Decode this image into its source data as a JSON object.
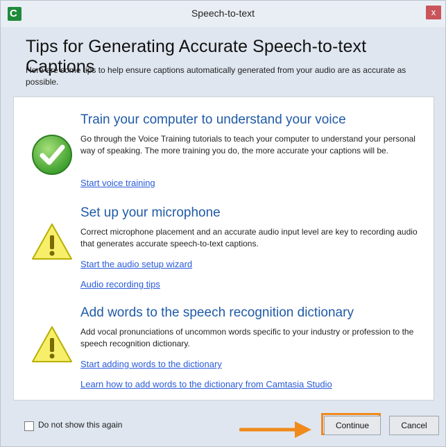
{
  "window": {
    "title": "Speech-to-text",
    "close_label": "x",
    "app_icon_letter": "C"
  },
  "header": {
    "title": "Tips for Generating Accurate Speech-to-text Captions",
    "description": "Here are some tips to help ensure captions automatically generated from your audio are as accurate as possible."
  },
  "tips": [
    {
      "title": "Train your computer to understand your voice",
      "text": "Go through the Voice Training tutorials to teach your computer to understand your personal way of speaking. The more training you do, the more accurate your captions will be.",
      "links": [
        "Start voice training"
      ],
      "icon": "check-icon"
    },
    {
      "title": "Set up your microphone",
      "text": "Correct microphone placement and an accurate audio input level are key to recording audio that generates accurate speech-to-text captions.",
      "links": [
        "Start the audio setup wizard",
        "Audio recording tips"
      ],
      "icon": "warning-icon"
    },
    {
      "title": "Add words to the speech recognition dictionary",
      "text": "Add vocal pronunciations of uncommon words specific to your industry or profession to the speech recognition dictionary.",
      "links": [
        "Start adding words to the dictionary",
        "Learn how to add words to the dictionary from Camtasia Studio"
      ],
      "icon": "warning-icon"
    }
  ],
  "footer": {
    "do_not_show_label": "Do not show this again",
    "continue_label": "Continue",
    "cancel_label": "Cancel"
  },
  "colors": {
    "heading_blue": "#1f5aa6",
    "link_blue": "#2a5bd7",
    "highlight_orange": "#f08a1c"
  }
}
